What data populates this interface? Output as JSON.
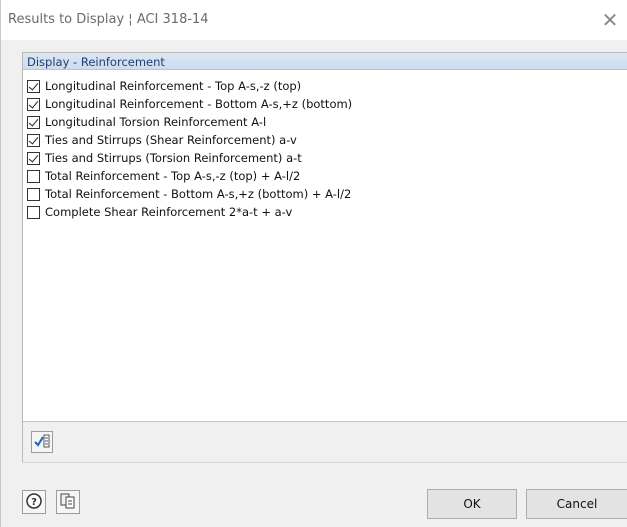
{
  "window": {
    "title": "Results to Display ¦ ACI 318-14",
    "close_glyph": "✕"
  },
  "section": {
    "header": "Display - Reinforcement"
  },
  "options": [
    {
      "label": "Longitudinal Reinforcement - Top A-s,-z (top)",
      "checked": true
    },
    {
      "label": "Longitudinal Reinforcement - Bottom A-s,+z (bottom)",
      "checked": true
    },
    {
      "label": "Longitudinal Torsion Reinforcement A-l",
      "checked": true
    },
    {
      "label": "Ties and Stirrups (Shear Reinforcement) a-v",
      "checked": true
    },
    {
      "label": "Ties and Stirrups (Torsion Reinforcement) a-t",
      "checked": true
    },
    {
      "label": "Total Reinforcement - Top A-s,-z (top) + A-l/2",
      "checked": false
    },
    {
      "label": "Total Reinforcement - Bottom A-s,+z (bottom) + A-l/2",
      "checked": false
    },
    {
      "label": "Complete Shear Reinforcement 2*a-t + a-v",
      "checked": false
    }
  ],
  "panel_tools": [
    {
      "icon": "select-all-checks-icon"
    }
  ],
  "footer": {
    "help_icon": "help-icon",
    "copy_icon": "copy-settings-icon",
    "ok_label": "OK",
    "cancel_label": "Cancel"
  },
  "colors": {
    "header_bg": "#cddbed",
    "header_text": "#1f3f73",
    "dialog_bg": "#f0f0f0",
    "button_bg": "#e3e3e3"
  }
}
